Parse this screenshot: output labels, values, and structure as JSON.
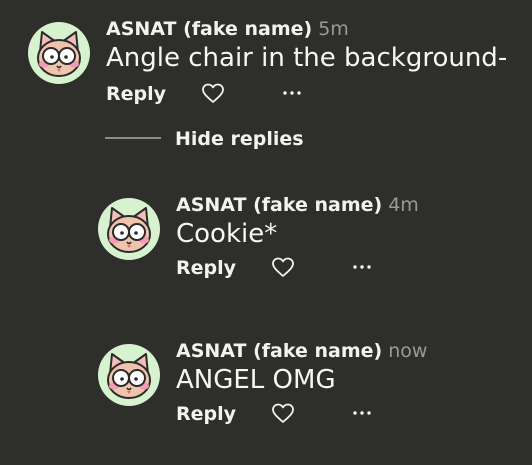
{
  "comments": [
    {
      "author": "ASNAT (fake name)",
      "time": "5m",
      "text": "Angle chair in the background-",
      "reply_label": "Reply"
    }
  ],
  "hide_replies_label": "Hide replies",
  "replies": [
    {
      "author": "ASNAT (fake name)",
      "time": "4m",
      "text": "Cookie*",
      "reply_label": "Reply"
    },
    {
      "author": "ASNAT (fake name)",
      "time": "now",
      "text": "ANGEL OMG",
      "reply_label": "Reply"
    }
  ],
  "icons": {
    "like": "heart-outline-icon",
    "more": "ellipsis-icon"
  },
  "colors": {
    "background": "#2e2e2b",
    "avatar_background": "#d6f2cf",
    "timestamp": "#9a9a95"
  }
}
